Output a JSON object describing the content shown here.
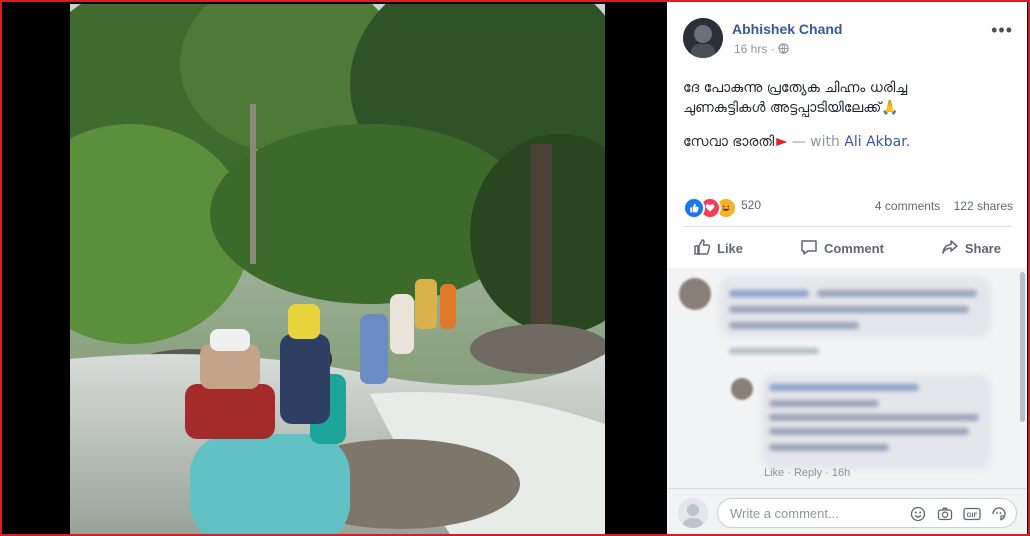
{
  "post": {
    "author": "Abhishek Chand",
    "time": "16 hrs",
    "privacy_icon": "globe-icon",
    "text_line1": "ദേ പോകുന്നു പ്രത്യേക ചിഹ്നം ധരിച്ച",
    "text_line2": "ചുണകുട്ടികൾ അട്ടപ്പാടിയിലേക്ക്",
    "text_line2_emoji": "🙏",
    "text_line3": "സേവാ ഭാരതി",
    "with_text": "— with",
    "tagged_name": "Ali Akbar."
  },
  "stats": {
    "reaction_count": "520",
    "comments": "4 comments",
    "shares": "122 shares"
  },
  "actions": {
    "like": "Like",
    "comment": "Comment",
    "share": "Share"
  },
  "comments": {
    "reply_meta": "Like · Reply · 16h"
  },
  "composer": {
    "placeholder": "Write a comment..."
  },
  "colors": {
    "frame": "#d32020",
    "link": "#385898",
    "like_blue": "#1877f2"
  }
}
